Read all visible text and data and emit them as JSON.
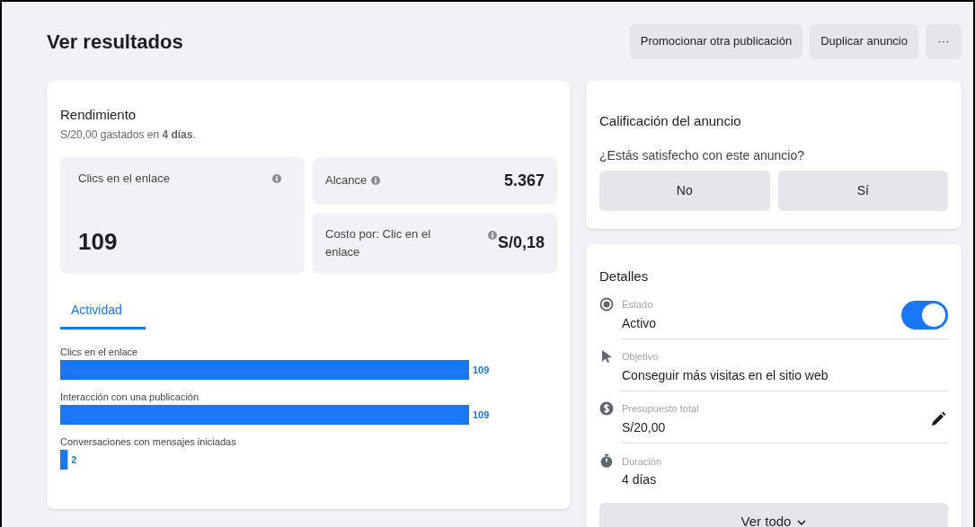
{
  "header": {
    "title": "Ver resultados",
    "buttons": [
      "Promocionar otra publicación",
      "Duplicar anuncio",
      "···"
    ]
  },
  "performance": {
    "title": "Rendimiento",
    "summary": "S/20,00 gastados en **4 días**.",
    "metrics": [
      {
        "label": "Clics en el enlace",
        "value": "109"
      },
      {
        "label": "Alcance",
        "value": "5.367"
      },
      {
        "label": "Costo por: Clic en el enlace",
        "value": "S/0,18"
      }
    ],
    "tabs": [
      {
        "label": "Actividad",
        "selected": true
      }
    ],
    "activity": {
      "chart_data": {
        "type": "bar",
        "orientation": "horizontal",
        "categories": [
          "Clics en el enlace",
          "Interacción con una publicación",
          "Conversaciones con mensajes iniciadas"
        ],
        "values": [
          109,
          109,
          2
        ],
        "data_labels": true
      }
    }
  },
  "rating": {
    "title": "Calificación del anuncio",
    "question": "¿Estás satisfecho con este anuncio?",
    "buttons": [
      "No",
      "Sí"
    ]
  },
  "details": {
    "title": "Detalles",
    "items": [
      {
        "kind": "status",
        "label": "Estado",
        "value": "Activo",
        "on": true
      },
      {
        "kind": "objective",
        "label": "Objetivo",
        "value": "Conseguir más visitas en el sitio web"
      },
      {
        "kind": "budget",
        "label": "Presupuesto total",
        "value": "S/20,00"
      },
      {
        "kind": "duration",
        "label": "Duración",
        "value": "4 días"
      }
    ],
    "more_button": "Ver todo"
  }
}
